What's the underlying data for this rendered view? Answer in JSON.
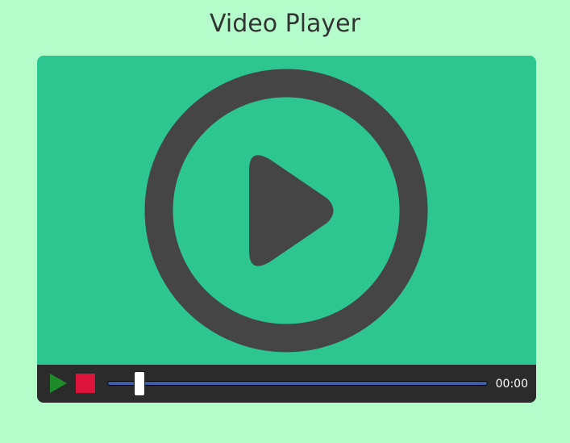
{
  "page": {
    "title": "Video Player",
    "background_color": "#b5fccb"
  },
  "player": {
    "screen_color": "#2ec690",
    "poster_icon": "play-circle-icon",
    "poster_icon_color": "#454545",
    "controls": {
      "background_color": "#2b2b2b",
      "play_icon": "play-icon",
      "play_color": "#1e8b2b",
      "stop_icon": "stop-icon",
      "stop_color": "#dc143c",
      "progress": {
        "fraction": 0.0,
        "track_color": "#000000",
        "fill_color": "#3a5fa8",
        "handle_color": "#ffffff"
      },
      "timestamp": "00:00"
    }
  }
}
